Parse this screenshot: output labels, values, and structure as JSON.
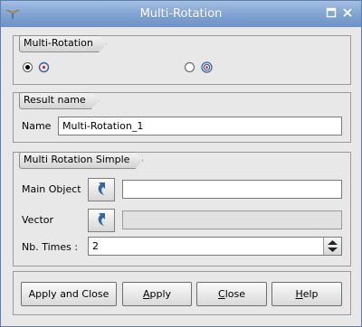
{
  "window": {
    "title": "Multi-Rotation"
  },
  "groups": {
    "multi_rotation": {
      "caption": "Multi-Rotation"
    },
    "result_name": {
      "caption": "Result name",
      "name_label": "Name",
      "name_value": "Multi-Rotation_1"
    },
    "multi_rotation_simple": {
      "caption": "Multi Rotation Simple",
      "main_object_label": "Main Object",
      "main_object_value": "",
      "vector_label": "Vector",
      "vector_value": "",
      "nb_times_label": "Nb. Times :",
      "nb_times_value": "2"
    }
  },
  "buttons": {
    "apply_and_close": "Apply and Close",
    "apply_first": "A",
    "apply_rest": "pply",
    "close_first": "C",
    "close_rest": "lose",
    "help_first": "H",
    "help_rest": "elp"
  },
  "colors": {
    "titlebar": "#7fa2d2",
    "select_arrow": "#35679a"
  }
}
